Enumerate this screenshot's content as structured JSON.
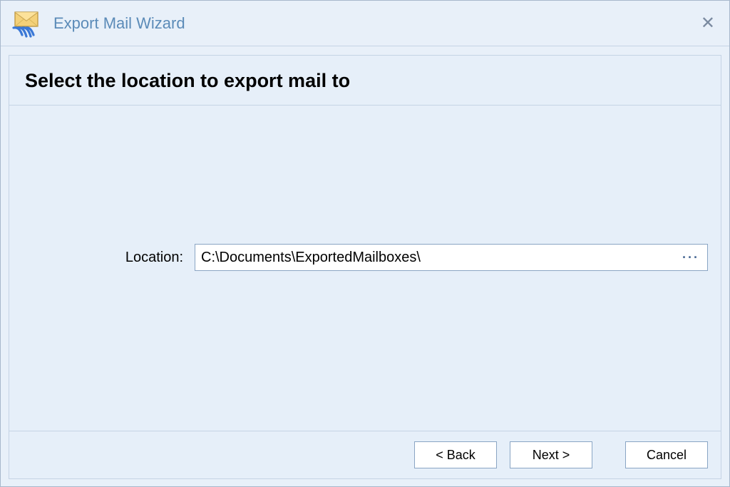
{
  "window": {
    "title": "Export Mail Wizard"
  },
  "page": {
    "heading": "Select the location to export mail to"
  },
  "form": {
    "location_label": "Location:",
    "location_value": "C:\\Documents\\ExportedMailboxes\\",
    "browse_ellipsis": "···"
  },
  "buttons": {
    "back": "< Back",
    "next": "Next >",
    "cancel": "Cancel"
  },
  "close_glyph": "✕"
}
